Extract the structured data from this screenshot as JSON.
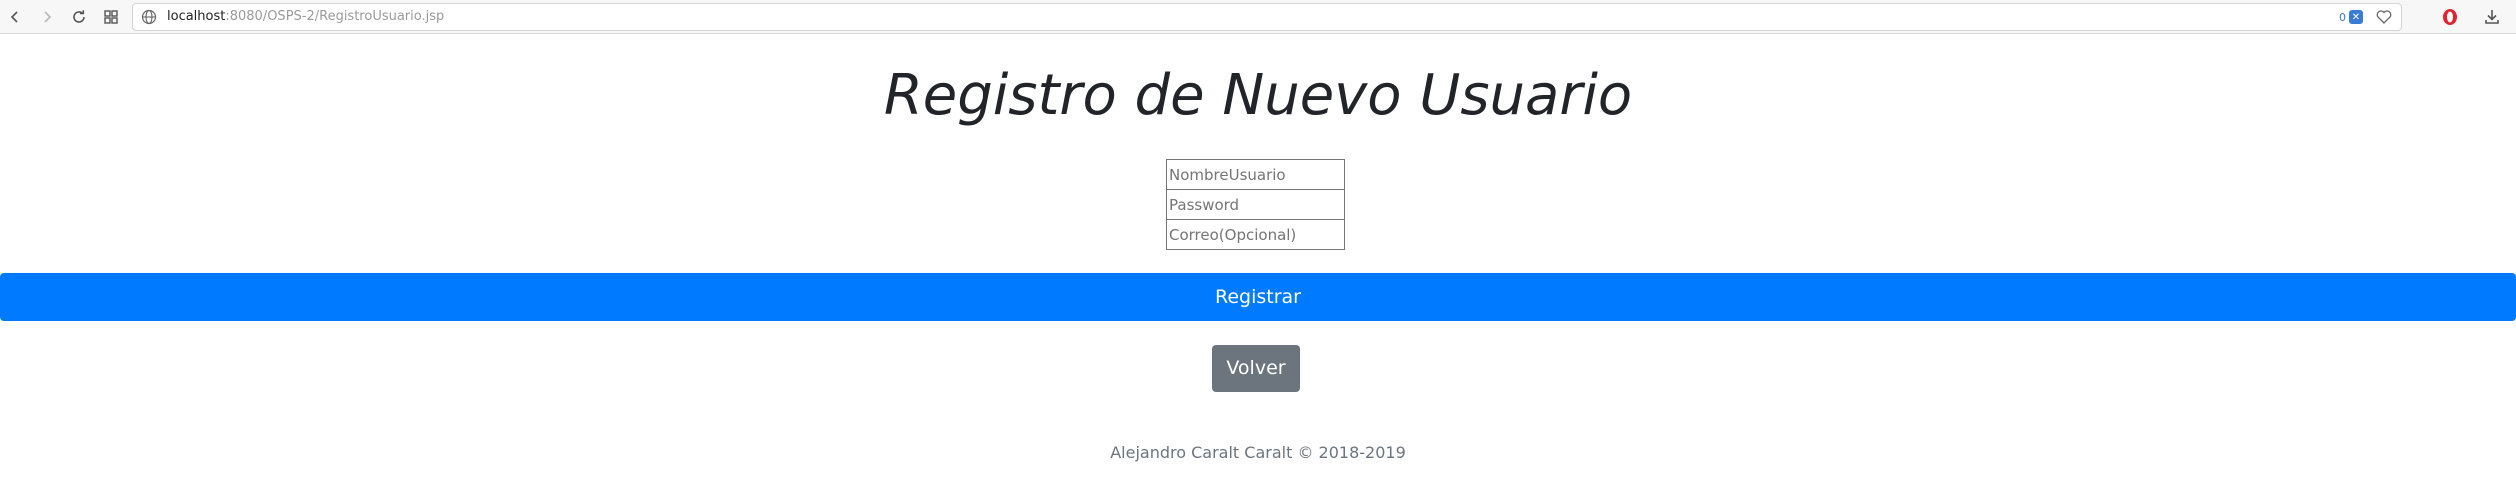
{
  "browser": {
    "url_host": "localhost",
    "url_path": ":8080/OSPS-2/RegistroUsuario.jsp",
    "tracker_count": "0"
  },
  "icons": {
    "back": "back-arrow-icon",
    "forward": "forward-arrow-icon",
    "reload": "reload-icon",
    "tabs": "tab-grid-icon",
    "site": "globe-icon",
    "shield": "shield-icon",
    "bookmark": "heart-icon",
    "opera": "opera-logo-icon",
    "download": "download-icon"
  },
  "colors": {
    "primary": "#007bff",
    "secondary": "#6c757d",
    "text": "#212529"
  },
  "page": {
    "title": "Registro de Nuevo Usuario"
  },
  "form": {
    "username_placeholder": "NombreUsuario",
    "password_placeholder": "Password",
    "email_placeholder": "Correo(Opcional)",
    "register_label": "Registrar",
    "back_label": "Volver"
  },
  "footer": {
    "text": "Alejandro Caralt Caralt © 2018-2019"
  }
}
